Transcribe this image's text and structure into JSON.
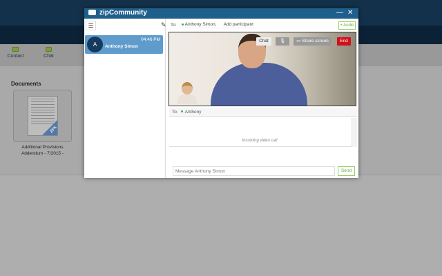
{
  "app": {
    "title": "zipCommunity"
  },
  "nav": {
    "contact": "Contact",
    "chat": "Chat"
  },
  "documents": {
    "heading": "Documents",
    "items": [
      {
        "caption_line1": "Additional Provisions",
        "caption_line2": "Addendum - 7/2015 -",
        "badge": "ZFX"
      }
    ]
  },
  "window": {
    "minimize": "—",
    "close": "✕"
  },
  "conversation": {
    "name": "Anthony Simon",
    "initial": "A",
    "time": "04:46 PM"
  },
  "header": {
    "to_label": "To:",
    "participant": "Anthony Simon,",
    "add_participant": "Add participant",
    "audio": "+ Audio"
  },
  "video": {
    "chat": "Chat",
    "share_screen": "Share screen",
    "end": "End"
  },
  "chat": {
    "to_label": "To:",
    "recipient": "Anthony",
    "status_text": "Incoming video call"
  },
  "composer": {
    "placeholder": "Message Anthony Simon",
    "send": "Send"
  },
  "colors": {
    "titlebar": "#1f5f8b",
    "end": "#d0101a",
    "accent_green": "#66aa33",
    "selected": "#5f9ccc"
  }
}
